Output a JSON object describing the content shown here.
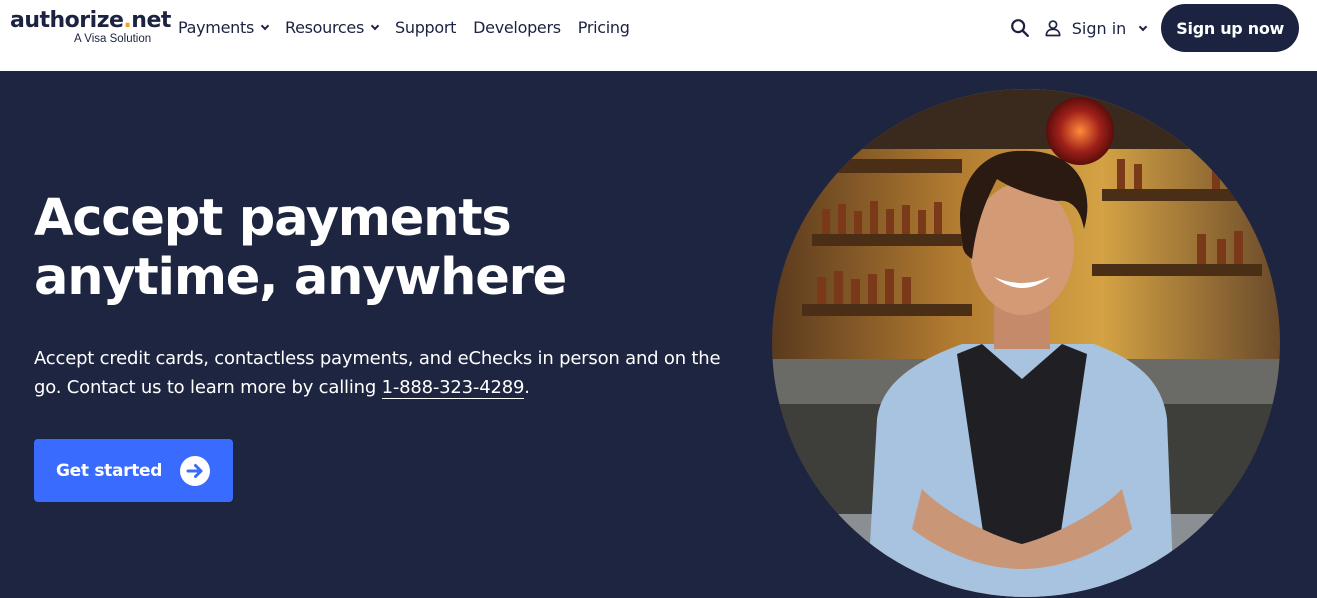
{
  "brand": {
    "name_part1": "authorize",
    "name_dot": ".",
    "name_part2": "net",
    "tagline": "A Visa Solution"
  },
  "nav": {
    "items": [
      {
        "label": "Payments",
        "has_dropdown": true
      },
      {
        "label": "Resources",
        "has_dropdown": true
      },
      {
        "label": "Support",
        "has_dropdown": false
      },
      {
        "label": "Developers",
        "has_dropdown": false
      },
      {
        "label": "Pricing",
        "has_dropdown": false
      }
    ]
  },
  "header_actions": {
    "search_icon": "search-icon",
    "signin_label": "Sign in",
    "signup_label": "Sign up now"
  },
  "hero": {
    "headline": "Accept payments anytime, anywhere",
    "description_text": "Accept credit cards, contactless payments, and eChecks in person and on the go. Contact us to learn more by calling ",
    "phone": "1-888-323-4289",
    "description_end": ".",
    "cta_label": "Get started"
  },
  "colors": {
    "navy": "#1e2540",
    "accent_blue": "#3a6bff",
    "logo_dot": "#f4a41a",
    "white": "#ffffff"
  }
}
